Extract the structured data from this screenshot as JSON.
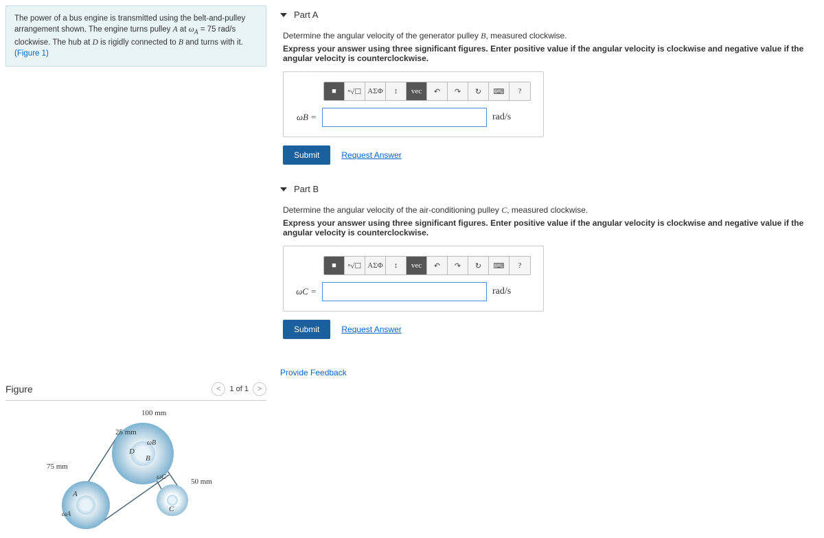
{
  "problem": {
    "text_1": "The power of a bus engine is transmitted using the belt-and-pulley arrangement shown. The engine turns pulley ",
    "pulley_A": "A",
    "text_2": " at ",
    "omega_A": "ω",
    "sub_A": "A",
    "text_3": " = 75 ",
    "units_radps": "rad/s",
    "text_4": " clockwise. The hub at ",
    "pulley_D": "D",
    "text_5": " is rigidly connected to ",
    "pulley_B": "B",
    "text_6": " and turns with it. ",
    "figure_link": "(Figure 1)"
  },
  "figure": {
    "title": "Figure",
    "count": "1 of 1",
    "label_100mm": "100 mm",
    "label_25mm": "25 mm",
    "label_75mm": "75 mm",
    "label_50mm": "50 mm",
    "label_A": "A",
    "label_B": "B",
    "label_C": "C",
    "label_D": "D",
    "label_omegaA": "ωA",
    "label_omegaB": "ωB",
    "label_omegaC": "ωC"
  },
  "parts": [
    {
      "title": "Part A",
      "prompt": "Determine the angular velocity of the generator pulley ",
      "prompt_var": "B",
      "prompt_end": ", measured clockwise.",
      "instruction": "Express your answer using three significant figures. Enter positive value if the angular velocity is clockwise and negative value if the angular velocity is counterclockwise.",
      "var_label": "ωB =",
      "unit": "rad/s",
      "submit": "Submit",
      "request": "Request Answer"
    },
    {
      "title": "Part B",
      "prompt": "Determine the angular velocity of the air-conditioning pulley ",
      "prompt_var": "C",
      "prompt_end": ", measured clockwise.",
      "instruction": "Express your answer using three significant figures. Enter positive value if the angular velocity is clockwise and negative value if the angular velocity is counterclockwise.",
      "var_label": "ωC =",
      "unit": "rad/s",
      "submit": "Submit",
      "request": "Request Answer"
    }
  ],
  "toolbar": {
    "templates": "■",
    "root": "ⁿ√☐",
    "greek": "ΑΣΦ",
    "subsup": "↕",
    "vec": "vec",
    "undo": "↶",
    "redo": "↷",
    "reset": "↻",
    "keyboard": "⌨",
    "help": "?"
  },
  "feedback": "Provide Feedback"
}
